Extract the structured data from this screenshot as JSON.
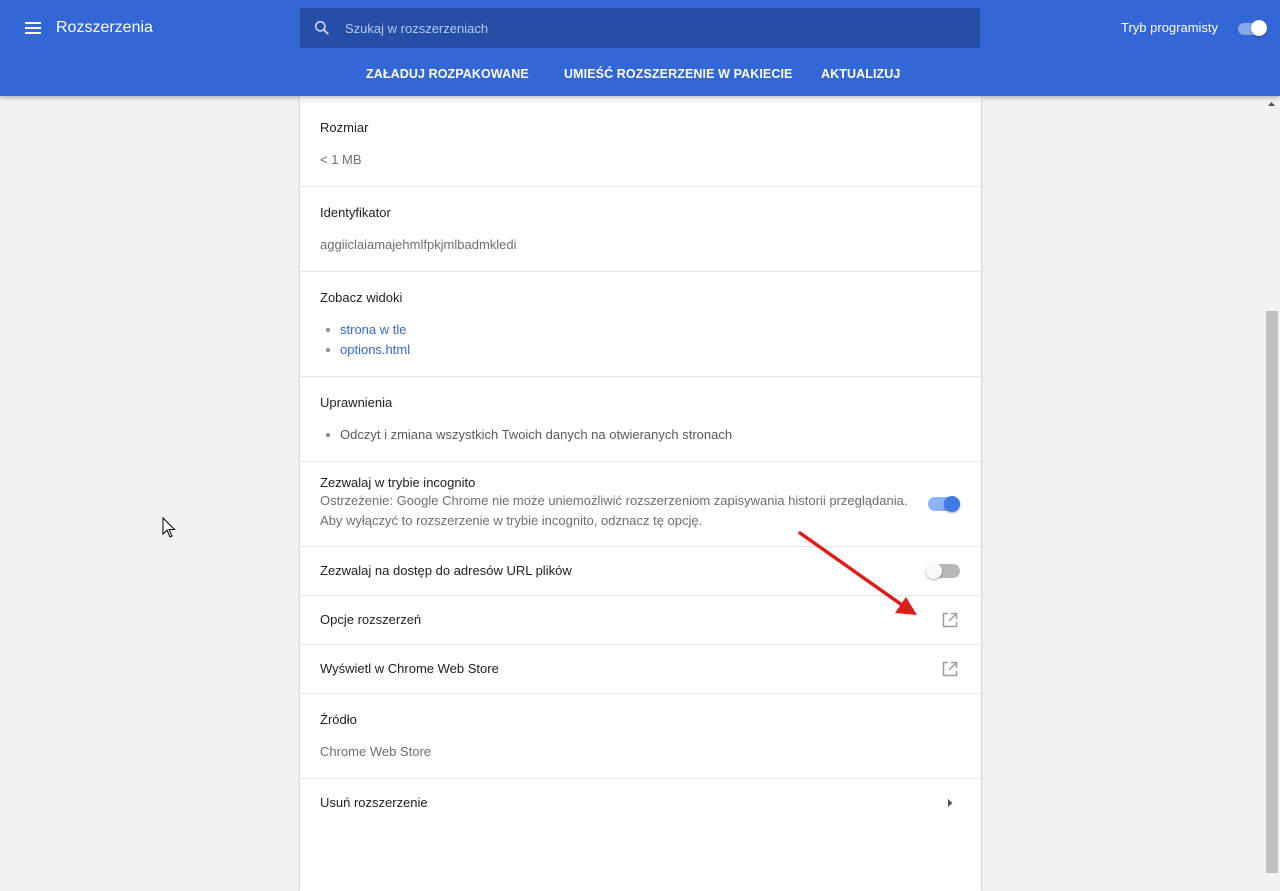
{
  "header": {
    "title": "Rozszerzenia",
    "search_placeholder": "Szukaj w rozszerzeniach",
    "dev_mode_label": "Tryb programisty",
    "dev_mode_enabled": true,
    "toolbar": {
      "load_unpacked": "ZAŁADUJ ROZPAKOWANE",
      "pack_extension": "UMIEŚĆ ROZSZERZENIE W PAKIECIE",
      "update": "AKTUALIZUJ"
    },
    "accent_color": "#3367d6"
  },
  "details": {
    "size": {
      "title": "Rozmiar",
      "value": "< 1 MB"
    },
    "id": {
      "title": "Identyfikator",
      "value": "aggiiclaiamajehmlfpkjmlbadmkledi"
    },
    "views": {
      "title": "Zobacz widoki",
      "items": [
        "strona w tle",
        "options.html"
      ]
    },
    "permissions": {
      "title": "Uprawnienia",
      "items": [
        "Odczyt i zmiana wszystkich Twoich danych na otwieranych stronach"
      ]
    },
    "incognito": {
      "title": "Zezwalaj w trybie incognito",
      "warning_line1": "Ostrzeżenie: Google Chrome nie może uniemożliwić rozszerzeniom zapisywania historii przeglądania.",
      "warning_line2": "Aby wyłączyć to rozszerzenie w trybie incognito, odznacz tę opcję.",
      "enabled": true
    },
    "file_urls": {
      "title": "Zezwalaj na dostęp do adresów URL plików",
      "enabled": false
    },
    "options": {
      "title": "Opcje rozszerzeń",
      "icon": "open-in-new-icon"
    },
    "webstore": {
      "title": "Wyświetl w Chrome Web Store",
      "icon": "open-in-new-icon"
    },
    "source": {
      "title": "Źródło",
      "value": "Chrome Web Store"
    },
    "remove": {
      "title": "Usuń rozszerzenie",
      "icon": "caret-right-icon"
    }
  }
}
